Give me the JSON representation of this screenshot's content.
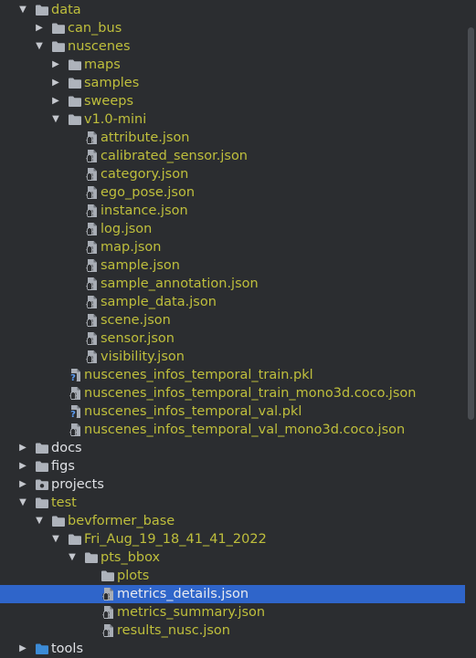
{
  "tree": [
    {
      "label": "data",
      "type": "folder",
      "depth": 0,
      "expanded": true,
      "color": "olive"
    },
    {
      "label": "can_bus",
      "type": "folder",
      "depth": 1,
      "expanded": false,
      "color": "olive"
    },
    {
      "label": "nuscenes",
      "type": "folder",
      "depth": 1,
      "expanded": true,
      "color": "olive"
    },
    {
      "label": "maps",
      "type": "folder",
      "depth": 2,
      "expanded": false,
      "color": "olive"
    },
    {
      "label": "samples",
      "type": "folder",
      "depth": 2,
      "expanded": false,
      "color": "olive"
    },
    {
      "label": "sweeps",
      "type": "folder",
      "depth": 2,
      "expanded": false,
      "color": "olive"
    },
    {
      "label": "v1.0-mini",
      "type": "folder",
      "depth": 2,
      "expanded": true,
      "color": "olive"
    },
    {
      "label": "attribute.json",
      "type": "json",
      "depth": 3,
      "color": "olive"
    },
    {
      "label": "calibrated_sensor.json",
      "type": "json",
      "depth": 3,
      "color": "olive"
    },
    {
      "label": "category.json",
      "type": "json",
      "depth": 3,
      "color": "olive"
    },
    {
      "label": "ego_pose.json",
      "type": "json",
      "depth": 3,
      "color": "olive"
    },
    {
      "label": "instance.json",
      "type": "json",
      "depth": 3,
      "color": "olive"
    },
    {
      "label": "log.json",
      "type": "json",
      "depth": 3,
      "color": "olive"
    },
    {
      "label": "map.json",
      "type": "json",
      "depth": 3,
      "color": "olive"
    },
    {
      "label": "sample.json",
      "type": "json",
      "depth": 3,
      "color": "olive"
    },
    {
      "label": "sample_annotation.json",
      "type": "json",
      "depth": 3,
      "color": "olive"
    },
    {
      "label": "sample_data.json",
      "type": "json",
      "depth": 3,
      "color": "olive"
    },
    {
      "label": "scene.json",
      "type": "json",
      "depth": 3,
      "color": "olive"
    },
    {
      "label": "sensor.json",
      "type": "json",
      "depth": 3,
      "color": "olive"
    },
    {
      "label": "visibility.json",
      "type": "json",
      "depth": 3,
      "color": "olive"
    },
    {
      "label": "nuscenes_infos_temporal_train.pkl",
      "type": "unknown",
      "depth": 2,
      "color": "olive"
    },
    {
      "label": "nuscenes_infos_temporal_train_mono3d.coco.json",
      "type": "json",
      "depth": 2,
      "color": "olive"
    },
    {
      "label": "nuscenes_infos_temporal_val.pkl",
      "type": "unknown",
      "depth": 2,
      "color": "olive"
    },
    {
      "label": "nuscenes_infos_temporal_val_mono3d.coco.json",
      "type": "json",
      "depth": 2,
      "color": "olive"
    },
    {
      "label": "docs",
      "type": "folder",
      "depth": 0,
      "expanded": false,
      "color": "plain"
    },
    {
      "label": "figs",
      "type": "folder",
      "depth": 0,
      "expanded": false,
      "color": "plain"
    },
    {
      "label": "projects",
      "type": "package",
      "depth": 0,
      "expanded": false,
      "color": "plain"
    },
    {
      "label": "test",
      "type": "folder",
      "depth": 0,
      "expanded": true,
      "color": "olive"
    },
    {
      "label": "bevformer_base",
      "type": "folder",
      "depth": 1,
      "expanded": true,
      "color": "olive"
    },
    {
      "label": "Fri_Aug_19_18_41_41_2022",
      "type": "folder",
      "depth": 2,
      "expanded": true,
      "color": "olive"
    },
    {
      "label": "pts_bbox",
      "type": "folder",
      "depth": 3,
      "expanded": true,
      "color": "olive"
    },
    {
      "label": "plots",
      "type": "folder",
      "depth": 4,
      "color": "olive"
    },
    {
      "label": "metrics_details.json",
      "type": "json",
      "depth": 4,
      "color": "olive",
      "selected": true
    },
    {
      "label": "metrics_summary.json",
      "type": "json",
      "depth": 4,
      "color": "olive"
    },
    {
      "label": "results_nusc.json",
      "type": "json",
      "depth": 4,
      "color": "olive"
    },
    {
      "label": "tools",
      "type": "folder",
      "depth": 0,
      "expanded": false,
      "color": "plain",
      "folder_color": "blue"
    }
  ],
  "colors": {
    "background": "#2b2d30",
    "olive_text": "#bfbf3c",
    "plain_text": "#dfe1e5",
    "selection": "#2f65ca",
    "folder": "#aeb3bb",
    "source_folder": "#3c8bd6"
  }
}
